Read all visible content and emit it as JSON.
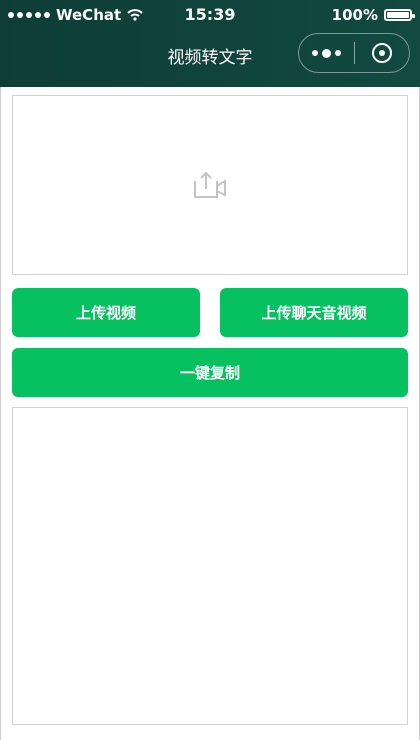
{
  "status_bar": {
    "carrier": "WeChat",
    "time": "15:39",
    "battery_text": "100%"
  },
  "nav": {
    "title": "视频转文字"
  },
  "upload_area": {
    "icon": "upload-icon"
  },
  "buttons": {
    "upload_video": "上传视频",
    "upload_chat_voice_video": "上传聊天音视频",
    "copy_all": "一键复制"
  },
  "result": {
    "text": ""
  },
  "colors": {
    "nav_bg": "#0e3d36",
    "accent": "#07c160"
  }
}
